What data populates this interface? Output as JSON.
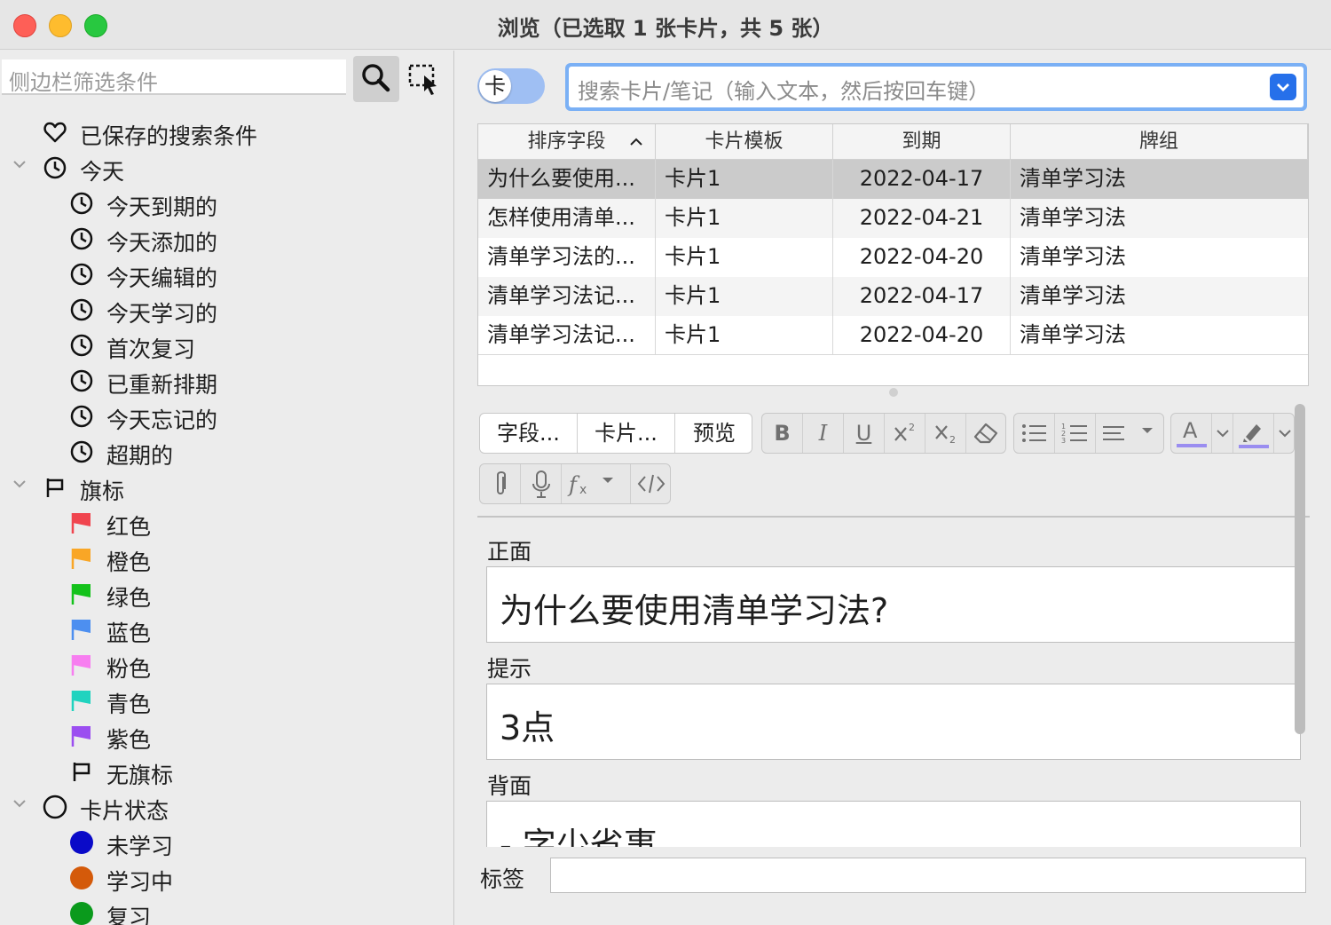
{
  "window": {
    "title": "浏览（已选取 1 张卡片，共 5 张）"
  },
  "sidebar": {
    "search_placeholder": "侧边栏筛选条件",
    "saved_searches": "已保存的搜索条件",
    "today": {
      "label": "今天",
      "items": [
        "今天到期的",
        "今天添加的",
        "今天编辑的",
        "今天学习的",
        "首次复习",
        "已重新排期",
        "今天忘记的",
        "超期的"
      ]
    },
    "flags": {
      "label": "旗标",
      "items": [
        {
          "label": "红色",
          "color": "#f0454f"
        },
        {
          "label": "橙色",
          "color": "#f9a626"
        },
        {
          "label": "绿色",
          "color": "#14c21b"
        },
        {
          "label": "蓝色",
          "color": "#4d8ff0"
        },
        {
          "label": "粉色",
          "color": "#f77ef0"
        },
        {
          "label": "青色",
          "color": "#20d3bf"
        },
        {
          "label": "紫色",
          "color": "#9b4ef0"
        }
      ],
      "no_flag": "无旗标"
    },
    "card_state": {
      "label": "卡片状态",
      "items": [
        {
          "label": "未学习",
          "color": "#0a0ac8"
        },
        {
          "label": "学习中",
          "color": "#d45a0a"
        },
        {
          "label": "复习",
          "color": "#0a9a1c"
        }
      ]
    }
  },
  "toolbar": {
    "toggle_label": "卡",
    "search_placeholder": "搜索卡片/笔记（输入文本，然后按回车键）"
  },
  "table": {
    "columns": [
      "排序字段",
      "卡片模板",
      "到期",
      "牌组"
    ],
    "rows": [
      [
        "为什么要使用...",
        "卡片1",
        "2022-04-17",
        "清单学习法"
      ],
      [
        "怎样使用清单...",
        "卡片1",
        "2022-04-21",
        "清单学习法"
      ],
      [
        "清单学习法的...",
        "卡片1",
        "2022-04-20",
        "清单学习法"
      ],
      [
        "清单学习法记...",
        "卡片1",
        "2022-04-17",
        "清单学习法"
      ],
      [
        "清单学习法记...",
        "卡片1",
        "2022-04-20",
        "清单学习法"
      ]
    ],
    "selected_row": 0
  },
  "editor": {
    "fields_button": "字段...",
    "cards_button": "卡片...",
    "preview_button": "预览",
    "bold": "B",
    "italic": "I",
    "underline": "U",
    "font_color": "A",
    "fields": [
      {
        "label": "正面",
        "value": "为什么要使用清单学习法?"
      },
      {
        "label": "提示",
        "value": "3点"
      },
      {
        "label": "背面",
        "value": "- 字少省事"
      }
    ],
    "tags_label": "标签",
    "tags_value": "",
    "accent_color": "#9a8df0"
  }
}
